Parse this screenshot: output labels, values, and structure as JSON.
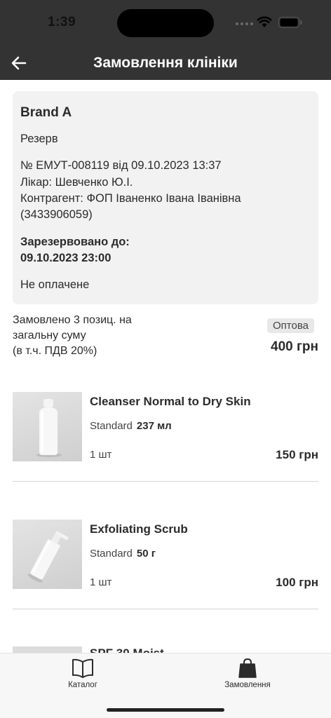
{
  "status_bar": {
    "time": "1:39"
  },
  "header": {
    "title": "Замовлення клініки",
    "back_icon": "arrow-left-icon"
  },
  "order": {
    "brand": "Brand A",
    "status": "Резерв",
    "number_line": "№ ЕМУТ-008119 від 09.10.2023 13:37",
    "doctor_line": "Лікар: Шевченко Ю.І.",
    "contractor_line1": "Контрагент: ФОП Іваненко Івана Іванівна",
    "contractor_line2": "(3433906059)",
    "reserved_label": "Зарезервовано до:",
    "reserved_until": "09.10.2023 23:00",
    "payment_status": "Не оплачене"
  },
  "summary": {
    "text": "Замовлено 3 позиц. на загальну суму",
    "vat": "(в т.ч. ПДВ 20%)",
    "badge": "Оптова",
    "total": "400 грн"
  },
  "items": [
    {
      "name": "Cleanser Normal to Dry Skin",
      "variant": "Standard",
      "size": "237 мл",
      "qty": "1 шт",
      "price": "150 грн"
    },
    {
      "name": "Exfoliating Scrub",
      "variant": "Standard",
      "size": "50 г",
      "qty": "1 шт",
      "price": "100 грн"
    },
    {
      "name": "SPF 30 Moist"
    }
  ],
  "tabbar": {
    "catalog": {
      "label": "Каталог",
      "icon": "book-icon"
    },
    "orders": {
      "label": "Замовлення",
      "icon": "shopping-bag-icon"
    }
  },
  "colors": {
    "header_bg": "#333333",
    "card_bg": "#f2f2f2",
    "text": "#2b2b2b"
  }
}
